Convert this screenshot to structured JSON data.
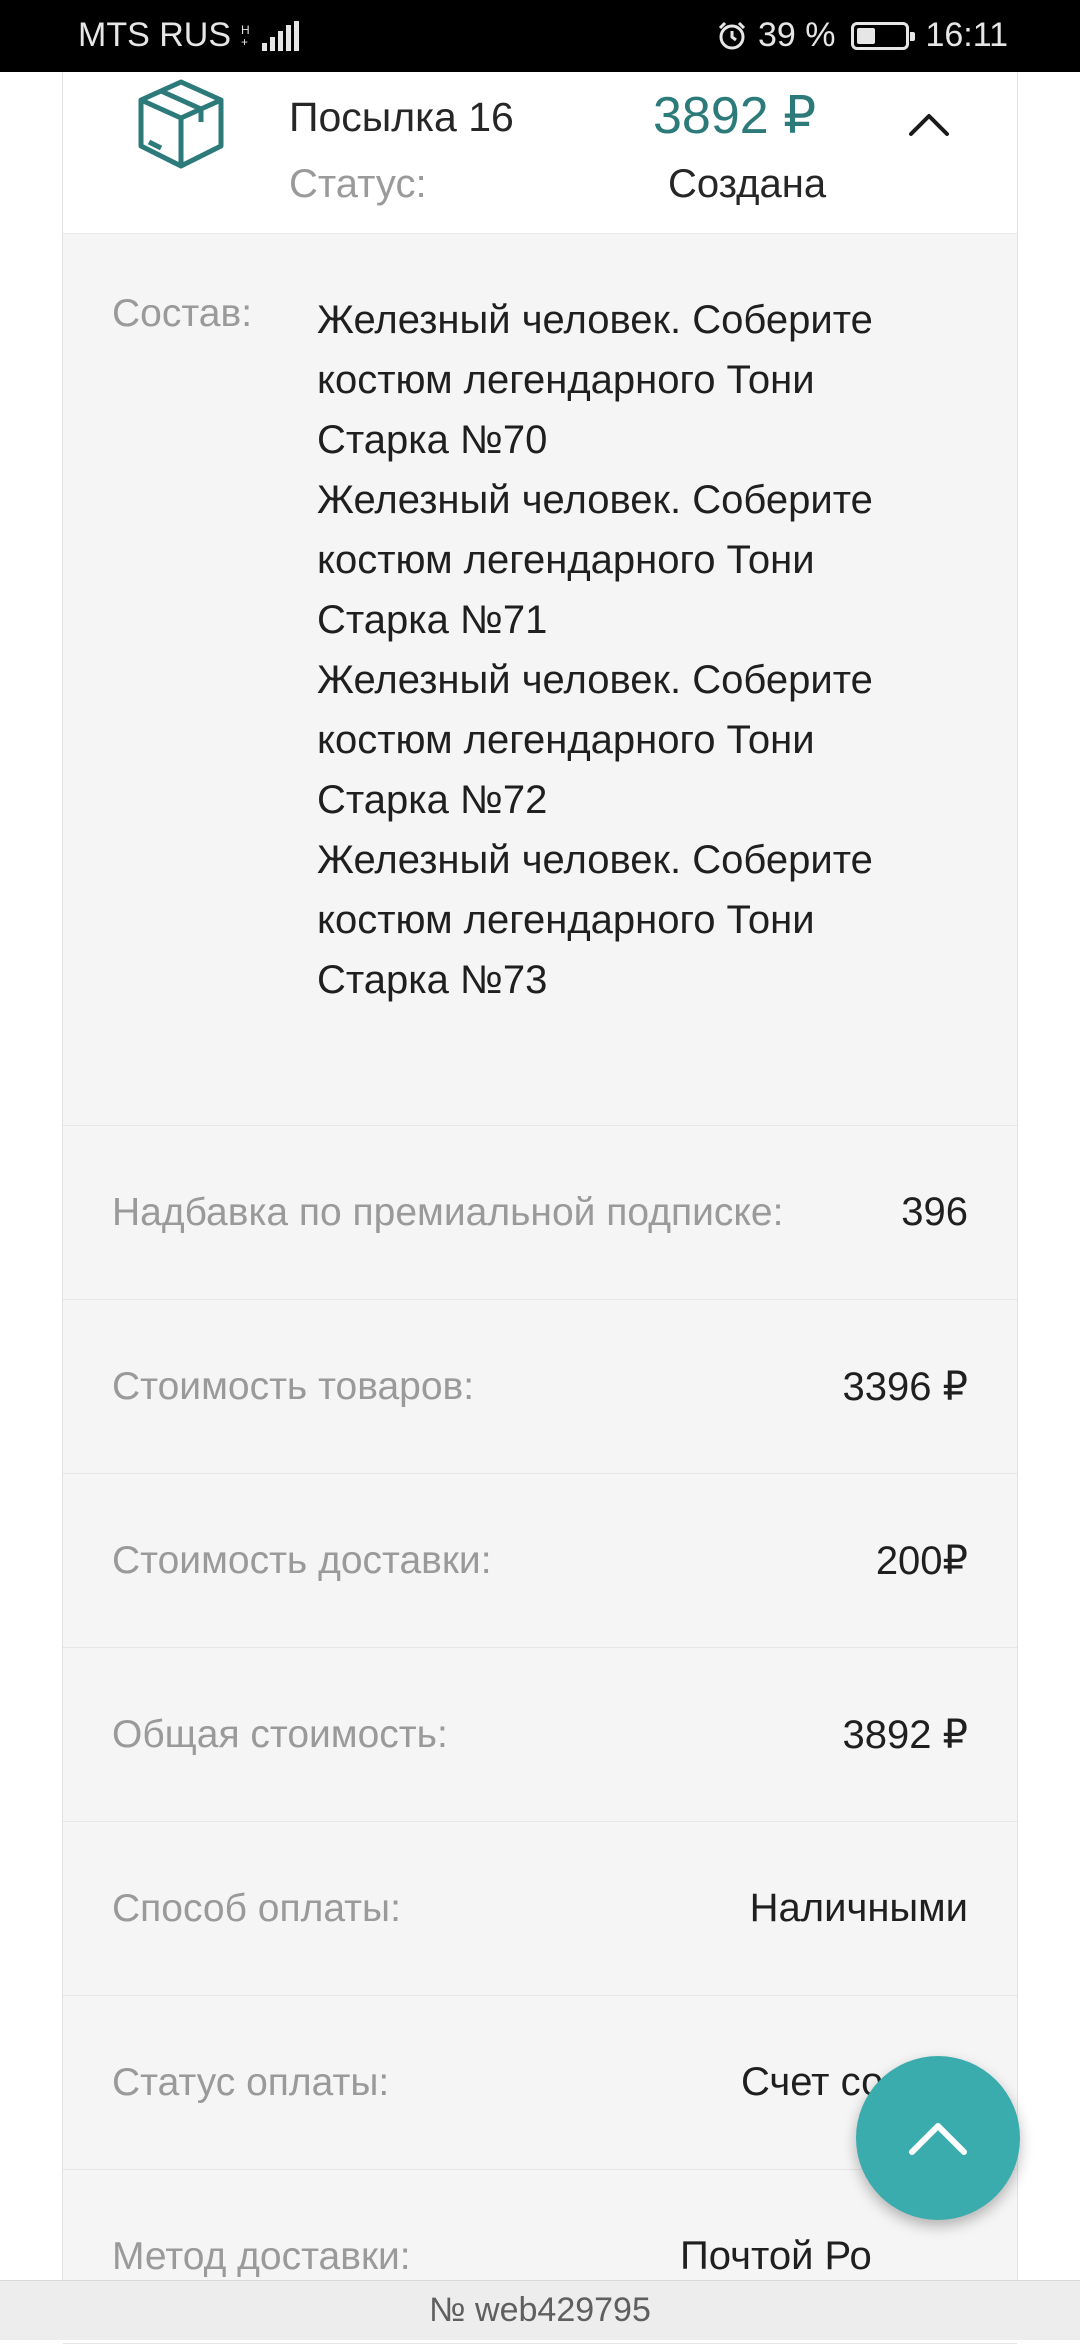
{
  "status_bar": {
    "carrier": "MTS RUS",
    "battery_percent": "39 %",
    "battery_level": 0.39,
    "time": "16:11"
  },
  "parcel": {
    "title": "Посылка 16",
    "price": "3892 ₽",
    "status_label": "Статус:",
    "status_value": "Создана",
    "composition_label": "Состав:",
    "composition_items": [
      "Железный человек. Соберите костюм легендарного Тони Старка №70",
      "Железный человек. Соберите костюм легендарного Тони Старка №71",
      "Железный человек. Соберите костюм легендарного Тони Старка №72",
      "Железный человек. Соберите костюм легендарного Тони Старка №73"
    ]
  },
  "details": [
    {
      "label": "Надбавка по премиальной подписке:",
      "value": "396"
    },
    {
      "label": "Стоимость товаров:",
      "value": "3396 ₽"
    },
    {
      "label": "Стоимость доставки:",
      "value": "200₽"
    },
    {
      "label": "Общая стоимость:",
      "value": "3892 ₽"
    },
    {
      "label": "Способ оплаты:",
      "value": "Наличными"
    },
    {
      "label": "Статус оплаты:",
      "value": "Счет создан"
    },
    {
      "label": "Метод доставки:",
      "value": "Почтой Ро"
    }
  ],
  "footer": {
    "order_number": "№ web429795"
  },
  "icons": {
    "parcel": "box-icon",
    "collapse": "chevron-up-icon",
    "scroll_top": "arrow-up-icon"
  },
  "colors": {
    "accent": "#2c7a7a",
    "fab": "#3aacad",
    "card_bg": "#f5f5f5",
    "label": "#9a9a9a"
  }
}
